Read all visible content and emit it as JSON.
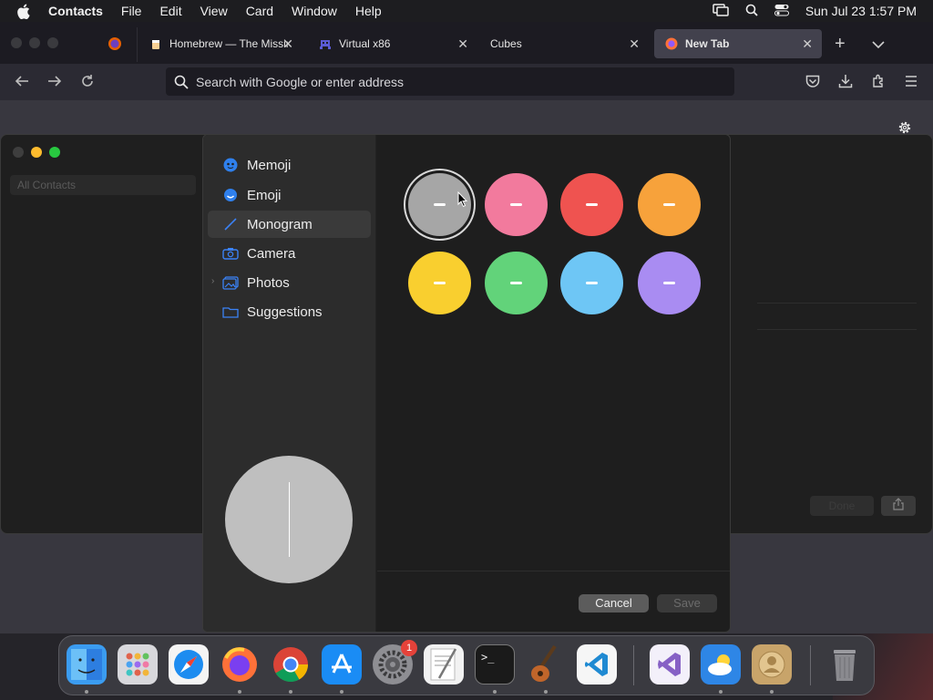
{
  "menubar": {
    "app_name": "Contacts",
    "items": [
      "File",
      "Edit",
      "View",
      "Card",
      "Window",
      "Help"
    ],
    "clock": "Sun Jul 23  1:57 PM"
  },
  "browser": {
    "tabs": [
      {
        "label": "Homebrew — The Missin",
        "icon": "homebrew-icon"
      },
      {
        "label": "Virtual x86",
        "icon": "space-invader-icon"
      },
      {
        "label": "Cubes",
        "icon": ""
      },
      {
        "label": "New Tab",
        "icon": "firefox-icon",
        "active": true
      }
    ],
    "url_placeholder": "Search with Google or enter address"
  },
  "contacts_window": {
    "sidebar_item": "All Contacts",
    "done_label": "Done"
  },
  "picker": {
    "sidebar": [
      {
        "label": "Memoji",
        "icon": "memoji-icon"
      },
      {
        "label": "Emoji",
        "icon": "emoji-icon"
      },
      {
        "label": "Monogram",
        "icon": "pencil-icon",
        "selected": true
      },
      {
        "label": "Camera",
        "icon": "camera-icon"
      },
      {
        "label": "Photos",
        "icon": "photos-icon",
        "expandable": true
      },
      {
        "label": "Suggestions",
        "icon": "folder-icon"
      }
    ],
    "swatches": [
      {
        "color": "#a6a6a6",
        "selected": true
      },
      {
        "color": "#f27a9d"
      },
      {
        "color": "#ef5350"
      },
      {
        "color": "#f7a23b"
      },
      {
        "color": "#f9cf2f"
      },
      {
        "color": "#62d37a"
      },
      {
        "color": "#6ec6f5"
      },
      {
        "color": "#a98cf2"
      }
    ],
    "cancel_label": "Cancel",
    "save_label": "Save"
  },
  "dock": {
    "apps": [
      "Finder",
      "Launchpad",
      "Safari",
      "Firefox",
      "Chrome",
      "App Store",
      "System Settings",
      "TextEdit",
      "Terminal",
      "GarageBand",
      "Visual Studio Code",
      "Visual Studio",
      "Weather",
      "Contacts",
      "Trash"
    ],
    "settings_badge": "1"
  }
}
